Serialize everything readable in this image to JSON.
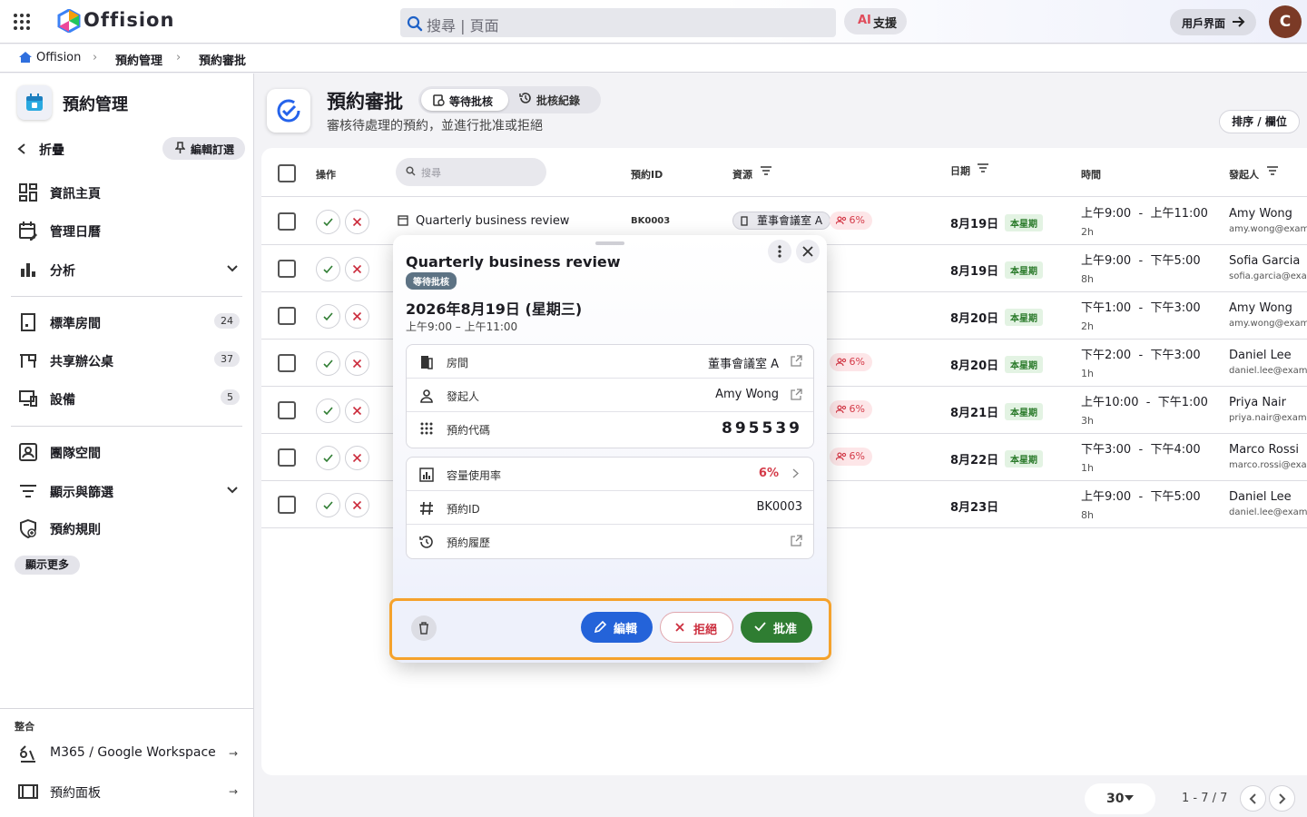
{
  "app": {
    "name": "Offision",
    "avatar_initial": "C"
  },
  "topbar": {
    "search_placeholder": "搜尋 | 頁面",
    "ai_prefix": "AI",
    "ai_label": "支援",
    "user_ui_label": "用戶界面"
  },
  "breadcrumb": [
    "Offision",
    "預約管理",
    "預約審批"
  ],
  "sidebar": {
    "title": "預約管理",
    "collapse_label": "折疊",
    "pin_label": "編輯訂選",
    "items": [
      {
        "label": "資訊主頁",
        "icon": "dashboard-icon"
      },
      {
        "label": "管理日曆",
        "icon": "calendar-edit-icon"
      },
      {
        "label": "分析",
        "icon": "bar-chart-icon"
      }
    ],
    "resources": [
      {
        "label": "標準房間",
        "count": "24",
        "icon": "room-icon"
      },
      {
        "label": "共享辦公桌",
        "count": "37",
        "icon": "desk-icon"
      },
      {
        "label": "設備",
        "count": "5",
        "icon": "device-icon"
      }
    ],
    "items2": [
      {
        "label": "團隊空間",
        "icon": "team-space-icon"
      },
      {
        "label": "顯示與篩選",
        "icon": "filter-icon"
      },
      {
        "label": "預約規則",
        "icon": "rules-icon"
      }
    ],
    "show_more": "顯示更多",
    "integration_label": "整合",
    "integrations": [
      {
        "label": "M365 / Google Workspace",
        "icon": "integration-icon"
      },
      {
        "label": "預約面板",
        "icon": "panel-icon"
      }
    ]
  },
  "page": {
    "title": "預約審批",
    "subtitle": "審核待處理的預約，並進行批准或拒絕",
    "tabs": [
      {
        "label": "等待批核"
      },
      {
        "label": "批核紀錄"
      }
    ],
    "sort_label": "排序 / 欄位"
  },
  "table": {
    "headers": {
      "action": "操作",
      "search": "搜尋",
      "id": "預約ID",
      "resource": "資源",
      "date": "日期",
      "time": "時間",
      "organizer": "發起人"
    },
    "rows": [
      {
        "title": "Quarterly business review",
        "id": "BK0003",
        "resource": "董事會議室 A",
        "capacity": "6%",
        "date": "8月19日",
        "week": "本星期",
        "start": "上午9:00",
        "end": "上午11:00",
        "duration": "2h",
        "name": "Amy Wong",
        "email": "amy.wong@example.com"
      },
      {
        "date": "8月19日",
        "week": "本星期",
        "start": "上午9:00",
        "end": "下午5:00",
        "duration": "8h",
        "name": "Sofia Garcia",
        "email": "sofia.garcia@example.com"
      },
      {
        "date": "8月20日",
        "week": "本星期",
        "start": "下午1:00",
        "end": "下午3:00",
        "duration": "2h",
        "name": "Amy Wong",
        "email": "amy.wong@example.com"
      },
      {
        "capacity": "6%",
        "date": "8月20日",
        "week": "本星期",
        "start": "下午2:00",
        "end": "下午3:00",
        "duration": "1h",
        "name": "Daniel Lee",
        "email": "daniel.lee@example.com"
      },
      {
        "capacity": "6%",
        "date": "8月21日",
        "week": "本星期",
        "start": "上午10:00",
        "end": "下午1:00",
        "duration": "3h",
        "name": "Priya Nair",
        "email": "priya.nair@example.com"
      },
      {
        "capacity": "6%",
        "date": "8月22日",
        "week": "本星期",
        "start": "下午3:00",
        "end": "下午4:00",
        "duration": "1h",
        "name": "Marco Rossi",
        "email": "marco.rossi@example.com"
      },
      {
        "date": "8月23日",
        "start": "上午9:00",
        "end": "下午5:00",
        "duration": "8h",
        "name": "Daniel Lee",
        "email": "daniel.lee@example.com"
      }
    ]
  },
  "pager": {
    "per_page": "30",
    "range": "1 - 7 / 7"
  },
  "popover": {
    "title": "Quarterly business review",
    "status": "等待批核",
    "date": "2026年8月19日 (星期三)",
    "time": "上午9:00 – 上午11:00",
    "room_label": "房間",
    "room_value": "董事會議室 A",
    "organizer_label": "發起人",
    "organizer_value": "Amy Wong",
    "code_label": "預約代碼",
    "code_value": "895539",
    "capacity_label": "容量使用率",
    "capacity_value": "6%",
    "id_label": "預約ID",
    "id_value": "BK0003",
    "history_label": "預約履歷",
    "edit_label": "編輯",
    "reject_label": "拒絕",
    "approve_label": "批准"
  },
  "colors": {
    "accent": "#2463d9",
    "approve": "#2f7d32",
    "reject": "#cc2e3e",
    "highlight": "#f5a22c",
    "week_badge": "#2a7a2a"
  }
}
